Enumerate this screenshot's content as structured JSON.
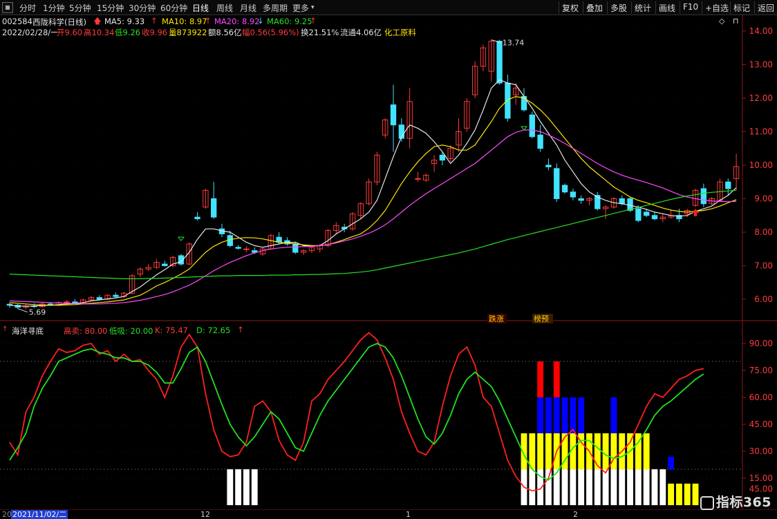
{
  "toolbar": {
    "periods": [
      "分时",
      "1分钟",
      "5分钟",
      "15分钟",
      "30分钟",
      "60分钟",
      "日线",
      "周线",
      "月线",
      "多周期",
      "更多"
    ],
    "active_period": "日线",
    "actions": [
      "复权",
      "叠加",
      "多股",
      "统计",
      "画线",
      "F10",
      "+自选",
      "标记",
      "返回"
    ]
  },
  "header": {
    "code": "002584",
    "name": "西陇科学(日线)",
    "ma5_label": "MA5: 9.33",
    "ma10_label": "MA10: 8.97",
    "ma20_label": "MA20: 8.92",
    "ma60_label": "MA60: 9.25",
    "date": "2022/02/28/一",
    "open": "开9.60",
    "high": "高10.34",
    "low": "低9.26",
    "close": "收9.96",
    "volume": "量873922",
    "amount": "额8.56亿",
    "change": "幅0.56(5.96%)",
    "turnover": "换21.51%",
    "float": "流通4.06亿",
    "sector": "化工原料"
  },
  "indicator_header": {
    "name": "海洋寻底",
    "high_sell": "高卖: 80.00",
    "low_buy": "低吸: 20.00",
    "k": "K: 75.47",
    "d": "D: 72.65"
  },
  "markers": {
    "max_price": "13.74",
    "min_price": "5.69",
    "tag1": "跌涨",
    "tag2": "榜预"
  },
  "x_labels": [
    "2021/11/02/二",
    "12",
    "1",
    "2"
  ],
  "watermark": "指标365",
  "colors": {
    "up": "#ff3b3b",
    "down": "#41e3ff",
    "ma5": "#e6e6e6",
    "ma10": "#ffe600",
    "ma20": "#ff4cff",
    "ma60": "#27e027",
    "k": "#ff2020",
    "d": "#20e020"
  },
  "chart_data": [
    {
      "type": "candlestick",
      "title": "西陇科学(日线)",
      "y_axis_ticks": [
        6.0,
        7.0,
        8.0,
        9.0,
        10.0,
        11.0,
        12.0,
        13.0,
        14.0
      ],
      "ylim": [
        5.5,
        14.2
      ],
      "ohlc": [
        [
          5.85,
          5.9,
          5.75,
          5.82
        ],
        [
          5.82,
          5.86,
          5.72,
          5.76
        ],
        [
          5.76,
          5.85,
          5.7,
          5.8
        ],
        [
          5.8,
          5.88,
          5.74,
          5.78
        ],
        [
          5.78,
          5.9,
          5.75,
          5.86
        ],
        [
          5.86,
          5.92,
          5.8,
          5.82
        ],
        [
          5.82,
          5.94,
          5.79,
          5.9
        ],
        [
          5.9,
          5.98,
          5.85,
          5.92
        ],
        [
          5.92,
          6.0,
          5.86,
          5.88
        ],
        [
          5.88,
          6.02,
          5.85,
          5.98
        ],
        [
          5.98,
          6.1,
          5.94,
          6.05
        ],
        [
          6.05,
          6.12,
          5.98,
          6.0
        ],
        [
          6.0,
          6.15,
          5.97,
          6.12
        ],
        [
          6.12,
          6.2,
          6.05,
          6.08
        ],
        [
          6.08,
          6.22,
          6.04,
          6.18
        ],
        [
          6.18,
          6.75,
          6.15,
          6.7
        ],
        [
          6.75,
          6.95,
          6.65,
          6.9
        ],
        [
          6.9,
          7.05,
          6.85,
          6.95
        ],
        [
          6.95,
          7.2,
          6.9,
          7.1
        ],
        [
          7.05,
          7.15,
          6.98,
          7.0
        ],
        [
          7.0,
          7.3,
          6.95,
          7.25
        ],
        [
          7.3,
          7.35,
          7.0,
          7.05
        ],
        [
          7.05,
          7.7,
          7.02,
          7.65
        ],
        [
          8.45,
          8.6,
          8.35,
          8.4
        ],
        [
          8.75,
          9.3,
          8.7,
          9.25
        ],
        [
          9.0,
          9.5,
          8.4,
          8.45
        ],
        [
          8.1,
          8.25,
          7.85,
          7.95
        ],
        [
          7.9,
          8.05,
          7.55,
          7.6
        ],
        [
          7.55,
          7.62,
          7.48,
          7.52
        ],
        [
          7.48,
          7.58,
          7.4,
          7.5
        ],
        [
          7.45,
          7.55,
          7.35,
          7.4
        ],
        [
          7.35,
          7.55,
          7.3,
          7.5
        ],
        [
          7.5,
          7.95,
          7.48,
          7.9
        ],
        [
          7.85,
          8.0,
          7.65,
          7.7
        ],
        [
          7.75,
          7.85,
          7.6,
          7.65
        ],
        [
          7.65,
          7.72,
          7.35,
          7.4
        ],
        [
          7.4,
          7.5,
          7.32,
          7.45
        ],
        [
          7.45,
          7.6,
          7.38,
          7.55
        ],
        [
          7.5,
          7.65,
          7.4,
          7.6
        ],
        [
          7.6,
          8.1,
          7.55,
          8.05
        ],
        [
          8.05,
          8.3,
          7.95,
          8.2
        ],
        [
          8.15,
          8.25,
          8.0,
          8.1
        ],
        [
          8.1,
          8.6,
          8.05,
          8.55
        ],
        [
          8.5,
          8.9,
          8.4,
          8.85
        ],
        [
          8.85,
          9.6,
          8.8,
          9.5
        ],
        [
          9.5,
          10.4,
          9.4,
          10.3
        ],
        [
          10.9,
          11.4,
          10.8,
          11.35
        ],
        [
          11.8,
          12.4,
          10.4,
          11.2
        ],
        [
          11.2,
          11.4,
          10.7,
          10.8
        ],
        [
          10.8,
          12.3,
          10.5,
          11.9
        ],
        [
          9.6,
          9.8,
          9.5,
          9.6
        ],
        [
          9.55,
          9.75,
          9.5,
          9.7
        ],
        [
          10.05,
          10.3,
          9.8,
          10.15
        ],
        [
          10.3,
          10.4,
          10.0,
          10.15
        ],
        [
          10.2,
          10.6,
          10.1,
          10.5
        ],
        [
          10.6,
          11.4,
          10.4,
          11.0
        ],
        [
          11.1,
          12.0,
          11.0,
          11.9
        ],
        [
          12.1,
          13.1,
          12.0,
          12.95
        ],
        [
          12.95,
          13.6,
          12.8,
          13.5
        ],
        [
          12.8,
          13.74,
          12.5,
          13.7
        ],
        [
          13.7,
          13.74,
          12.4,
          12.45
        ],
        [
          12.45,
          12.7,
          11.3,
          11.4
        ],
        [
          12.1,
          12.45,
          11.8,
          12.3
        ],
        [
          12.05,
          12.3,
          11.6,
          11.65
        ],
        [
          11.5,
          11.6,
          10.8,
          10.85
        ],
        [
          10.9,
          11.2,
          10.4,
          10.5
        ],
        [
          10.0,
          10.2,
          9.85,
          9.95
        ],
        [
          9.9,
          10.05,
          8.9,
          9.0
        ],
        [
          9.4,
          9.45,
          9.15,
          9.2
        ],
        [
          9.2,
          9.3,
          8.95,
          9.05
        ],
        [
          9.0,
          9.1,
          8.85,
          8.95
        ],
        [
          8.95,
          9.05,
          8.8,
          9.0
        ],
        [
          9.1,
          9.2,
          8.65,
          8.7
        ],
        [
          8.7,
          8.8,
          8.4,
          8.75
        ],
        [
          8.75,
          9.05,
          8.7,
          9.0
        ],
        [
          9.0,
          9.1,
          8.8,
          8.85
        ],
        [
          9.0,
          9.05,
          8.6,
          8.65
        ],
        [
          8.7,
          8.8,
          8.3,
          8.35
        ],
        [
          8.6,
          8.7,
          8.45,
          8.5
        ],
        [
          8.5,
          8.6,
          8.35,
          8.4
        ],
        [
          8.4,
          8.55,
          8.3,
          8.45
        ],
        [
          8.45,
          8.65,
          8.4,
          8.5
        ],
        [
          8.5,
          8.7,
          8.3,
          8.4
        ],
        [
          8.55,
          8.7,
          8.45,
          8.65
        ],
        [
          8.8,
          9.3,
          8.75,
          9.25
        ],
        [
          9.3,
          9.45,
          8.75,
          8.85
        ],
        [
          8.85,
          9.05,
          8.8,
          9.0
        ],
        [
          8.95,
          9.6,
          8.9,
          9.5
        ],
        [
          9.5,
          9.6,
          9.1,
          9.3
        ],
        [
          9.6,
          10.34,
          9.26,
          9.96
        ]
      ],
      "series": [
        {
          "name": "MA5",
          "color": "#e6e6e6",
          "values": [
            5.82,
            5.8,
            5.79,
            5.8,
            5.81,
            5.82,
            5.84,
            5.86,
            5.87,
            5.9,
            5.95,
            5.98,
            6.01,
            6.04,
            6.08,
            6.23,
            6.37,
            6.55,
            6.73,
            6.88,
            7.05,
            7.12,
            7.4,
            7.79,
            8.1,
            8.1,
            8.04,
            8.0,
            7.85,
            7.7,
            7.6,
            7.55,
            7.6,
            7.65,
            7.7,
            7.7,
            7.6,
            7.58,
            7.6,
            7.75,
            7.95,
            8.1,
            8.25,
            8.4,
            8.6,
            8.95,
            9.6,
            10.25,
            10.85,
            11.2,
            11.1,
            10.95,
            10.7,
            10.4,
            10.05,
            10.3,
            10.65,
            11.05,
            11.65,
            12.3,
            12.55,
            12.45,
            12.4,
            12.05,
            11.7,
            11.3,
            10.95,
            10.6,
            10.15,
            9.8,
            9.45,
            9.2,
            9.05,
            8.95,
            8.88,
            8.85,
            8.8,
            8.75,
            8.68,
            8.6,
            8.55,
            8.5,
            8.48,
            8.5,
            8.62,
            8.7,
            8.78,
            8.95,
            9.1,
            9.33
          ]
        },
        {
          "name": "MA10",
          "color": "#ffe600",
          "values": [
            5.9,
            5.88,
            5.86,
            5.84,
            5.83,
            5.82,
            5.82,
            5.83,
            5.84,
            5.86,
            5.88,
            5.9,
            5.92,
            5.95,
            5.98,
            6.05,
            6.12,
            6.25,
            6.4,
            6.5,
            6.62,
            6.75,
            6.9,
            7.15,
            7.4,
            7.58,
            7.7,
            7.78,
            7.82,
            7.84,
            7.83,
            7.8,
            7.75,
            7.7,
            7.68,
            7.65,
            7.62,
            7.6,
            7.6,
            7.63,
            7.7,
            7.78,
            7.87,
            7.95,
            8.12,
            8.35,
            8.65,
            9.05,
            9.45,
            9.8,
            10.1,
            10.35,
            10.55,
            10.6,
            10.55,
            10.45,
            10.45,
            10.6,
            10.95,
            11.3,
            11.7,
            11.95,
            12.05,
            12.0,
            11.85,
            11.65,
            11.4,
            11.1,
            10.8,
            10.5,
            10.2,
            9.95,
            9.75,
            9.55,
            9.35,
            9.2,
            9.05,
            8.95,
            8.88,
            8.8,
            8.72,
            8.66,
            8.62,
            8.6,
            8.62,
            8.65,
            8.7,
            8.78,
            8.88,
            8.97
          ]
        },
        {
          "name": "MA20",
          "color": "#ff4cff",
          "values": [
            5.95,
            5.94,
            5.93,
            5.92,
            5.91,
            5.9,
            5.89,
            5.88,
            5.87,
            5.86,
            5.86,
            5.86,
            5.87,
            5.88,
            5.9,
            5.93,
            5.97,
            6.02,
            6.08,
            6.14,
            6.22,
            6.32,
            6.42,
            6.55,
            6.7,
            6.85,
            6.98,
            7.1,
            7.2,
            7.3,
            7.38,
            7.45,
            7.5,
            7.53,
            7.55,
            7.56,
            7.57,
            7.58,
            7.6,
            7.63,
            7.68,
            7.74,
            7.8,
            7.88,
            7.97,
            8.08,
            8.22,
            8.4,
            8.6,
            8.8,
            8.98,
            9.15,
            9.3,
            9.45,
            9.6,
            9.75,
            9.9,
            10.05,
            10.25,
            10.45,
            10.65,
            10.85,
            10.98,
            11.05,
            11.05,
            11.0,
            10.9,
            10.78,
            10.65,
            10.5,
            10.35,
            10.2,
            10.05,
            9.92,
            9.8,
            9.7,
            9.62,
            9.55,
            9.48,
            9.4,
            9.32,
            9.22,
            9.12,
            9.05,
            9.0,
            8.96,
            8.93,
            8.92,
            8.91,
            8.92
          ]
        },
        {
          "name": "MA60",
          "color": "#27e027",
          "values": [
            6.75,
            6.74,
            6.73,
            6.72,
            6.71,
            6.7,
            6.69,
            6.68,
            6.67,
            6.66,
            6.65,
            6.64,
            6.63,
            6.62,
            6.61,
            6.61,
            6.61,
            6.62,
            6.62,
            6.63,
            6.64,
            6.65,
            6.66,
            6.67,
            6.68,
            6.69,
            6.7,
            6.7,
            6.71,
            6.71,
            6.71,
            6.71,
            6.72,
            6.72,
            6.72,
            6.73,
            6.73,
            6.74,
            6.74,
            6.75,
            6.76,
            6.77,
            6.79,
            6.81,
            6.84,
            6.88,
            6.93,
            6.98,
            7.03,
            7.08,
            7.13,
            7.18,
            7.23,
            7.28,
            7.33,
            7.38,
            7.44,
            7.5,
            7.57,
            7.64,
            7.71,
            7.78,
            7.84,
            7.9,
            7.96,
            8.02,
            8.08,
            8.14,
            8.2,
            8.26,
            8.32,
            8.38,
            8.44,
            8.5,
            8.56,
            8.62,
            8.68,
            8.74,
            8.8,
            8.86,
            8.92,
            8.98,
            9.03,
            9.08,
            9.12,
            9.16,
            9.19,
            9.21,
            9.23,
            9.25
          ]
        }
      ]
    },
    {
      "type": "line",
      "title": "海洋寻底",
      "y_axis_ticks": [
        15.0,
        30.0,
        45.0,
        60.0,
        75.0,
        90.0
      ],
      "ylim": [
        0,
        100
      ],
      "series": [
        {
          "name": "K",
          "color": "#ff2020",
          "values": [
            35,
            28,
            52,
            60,
            72,
            80,
            87,
            85,
            86,
            89,
            90,
            84,
            86,
            80,
            84,
            80,
            81,
            75,
            70,
            60,
            72,
            88,
            95,
            88,
            62,
            42,
            30,
            27,
            28,
            35,
            55,
            58,
            52,
            36,
            28,
            25,
            35,
            58,
            62,
            70,
            75,
            80,
            86,
            92,
            96,
            92,
            82,
            70,
            52,
            40,
            30,
            28,
            35,
            55,
            72,
            84,
            88,
            78,
            60,
            55,
            40,
            25,
            16,
            10,
            8,
            9,
            15,
            30,
            38,
            42,
            35,
            30,
            22,
            18,
            26,
            30,
            35,
            45,
            55,
            62,
            60,
            65,
            70,
            72,
            75,
            76
          ]
        },
        {
          "name": "D",
          "color": "#20e020",
          "values": [
            25,
            32,
            40,
            55,
            65,
            72,
            80,
            82,
            84,
            86,
            87,
            85,
            84,
            82,
            82,
            80,
            80,
            78,
            74,
            68,
            68,
            76,
            85,
            88,
            80,
            68,
            56,
            45,
            38,
            33,
            38,
            45,
            52,
            48,
            40,
            32,
            30,
            40,
            50,
            58,
            64,
            70,
            76,
            82,
            88,
            90,
            88,
            82,
            72,
            60,
            48,
            38,
            34,
            40,
            50,
            62,
            70,
            74,
            70,
            66,
            58,
            48,
            38,
            28,
            20,
            16,
            14,
            18,
            25,
            32,
            36,
            36,
            32,
            28,
            26,
            27,
            30,
            35,
            42,
            50,
            55,
            58,
            62,
            66,
            70,
            73
          ]
        }
      ]
    }
  ]
}
